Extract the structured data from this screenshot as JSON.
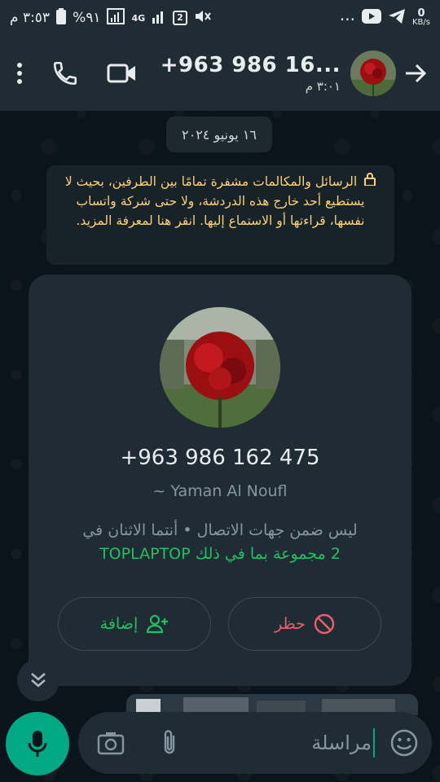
{
  "status_bar": {
    "time": "٣:٥٣ م",
    "battery": "%٩١",
    "network": "4G",
    "sim_badge": "2",
    "speed_value": "0",
    "speed_unit": "KB/s",
    "menu_dots": "..."
  },
  "header": {
    "contact_name": "+963 986 16...",
    "last_seen": "٣:٠١ م"
  },
  "chat": {
    "date_label": "١٦ يونيو ٢٠٢٤",
    "encryption_notice": "الرسائل والمكالمات مشفرة تمامًا بين الطرفين، بحيث لا يستطيع أحد خارج هذه الدردشة، ولا حتى شركة واتساب نفسها، قراءتها أو الاستماع إليها. انقر هنا لمعرفة المزيد."
  },
  "contact_card": {
    "phone": "+963 986 162 475",
    "alias": "~ Yaman Al Noufl",
    "not_in_contacts": "ليس ضمن جهات الاتصال • أنتما الاثنان في",
    "groups": "2 مجموعة بما في ذلك TOPLAPTOP",
    "add_label": "إضافة",
    "block_label": "حظر"
  },
  "input": {
    "placeholder": "مراسلة"
  },
  "colors": {
    "accent_green": "#21c063",
    "fab_green": "#00a884",
    "block_red": "#f15c6d",
    "notice_yellow": "#ffd279"
  }
}
